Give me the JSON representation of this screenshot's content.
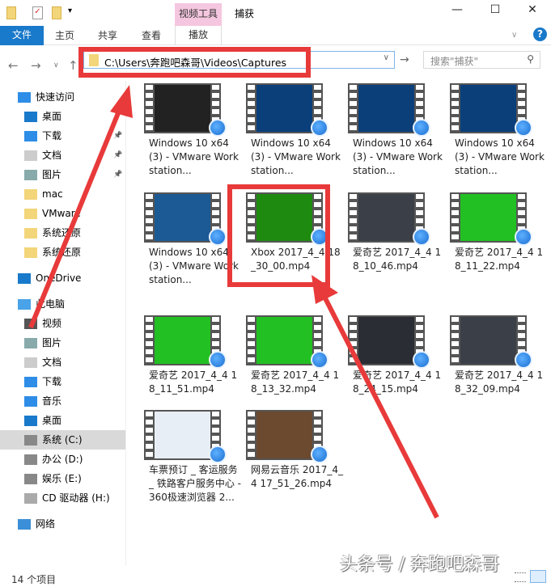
{
  "titlebar": {
    "context_tab": "视频工具",
    "title": "捕获",
    "minimize": "—",
    "maximize": "☐",
    "close": "✕"
  },
  "ribbon": {
    "file": "文件",
    "tabs": [
      "主页",
      "共享",
      "查看"
    ],
    "play": "播放",
    "help": "?"
  },
  "address": {
    "path": "C:\\Users\\奔跑吧森哥\\Videos\\Captures",
    "search_placeholder": "搜索\"捕获\""
  },
  "sidebar": {
    "items": [
      {
        "label": "快速访问",
        "icon": "star-icon"
      },
      {
        "label": "桌面",
        "icon": "desktop-icon"
      },
      {
        "label": "下载",
        "icon": "download-icon"
      },
      {
        "label": "文档",
        "icon": "document-icon"
      },
      {
        "label": "图片",
        "icon": "pictures-icon"
      },
      {
        "label": "mac",
        "icon": "folder-icon"
      },
      {
        "label": "VMware",
        "icon": "folder-icon"
      },
      {
        "label": "系统还原",
        "icon": "folder-icon"
      },
      {
        "label": "系统还原",
        "icon": "folder-icon"
      },
      {
        "label": "OneDrive",
        "icon": "cloud-icon"
      },
      {
        "label": "此电脑",
        "icon": "computer-icon"
      },
      {
        "label": "视频",
        "icon": "video-icon"
      },
      {
        "label": "图片",
        "icon": "pictures-icon"
      },
      {
        "label": "文档",
        "icon": "document-icon"
      },
      {
        "label": "下载",
        "icon": "download-icon"
      },
      {
        "label": "音乐",
        "icon": "music-icon"
      },
      {
        "label": "桌面",
        "icon": "desktop-icon"
      },
      {
        "label": "系统 (C:)",
        "icon": "drive-icon"
      },
      {
        "label": "办公 (D:)",
        "icon": "drive-icon"
      },
      {
        "label": "娱乐 (E:)",
        "icon": "drive-icon"
      },
      {
        "label": "CD 驱动器 (H:)",
        "icon": "cd-icon"
      },
      {
        "label": "网络",
        "icon": "network-icon"
      }
    ]
  },
  "files": [
    {
      "name": "Windows 10 x64 (3) - VMware Workstation...",
      "thumb": "#222"
    },
    {
      "name": "Windows 10 x64 (3) - VMware Workstation...",
      "thumb": "#0a3f7a"
    },
    {
      "name": "Windows 10 x64 (3) - VMware Workstation...",
      "thumb": "#0a3f7a"
    },
    {
      "name": "Windows 10 x64 (3) - VMware Workstation...",
      "thumb": "#0a3f7a"
    },
    {
      "name": "Windows 10 x64 (3) - VMware Workstation...",
      "thumb": "#1b5a94"
    },
    {
      "name": "Xbox 2017_4_4 18_30_00.mp4",
      "thumb": "#1f8a10"
    },
    {
      "name": "爱奇艺 2017_4_4 18_10_46.mp4",
      "thumb": "#3a3f48"
    },
    {
      "name": "爱奇艺 2017_4_4 18_11_22.mp4",
      "thumb": "#22c022"
    },
    {
      "name": "爱奇艺 2017_4_4 18_11_51.mp4",
      "thumb": "#22c022"
    },
    {
      "name": "爱奇艺 2017_4_4 18_13_32.mp4",
      "thumb": "#22c022"
    },
    {
      "name": "爱奇艺 2017_4_4 18_24_15.mp4",
      "thumb": "#2a2d33"
    },
    {
      "name": "爱奇艺 2017_4_4 18_32_09.mp4",
      "thumb": "#3a3f48"
    },
    {
      "name": "车票预订 _ 客运服务 _ 铁路客户服务中心 - 360极速浏览器 2...",
      "thumb": "#e8eef5"
    },
    {
      "name": "网易云音乐 2017_4_4 17_51_26.mp4",
      "thumb": "#6b4a30"
    }
  ],
  "status": "14 个项目",
  "watermark": "头条号 / 奔跑吧森哥",
  "colors": {
    "accent": "#1979ca",
    "highlight": "#e83a3a",
    "context_tab": "#f5c6df"
  }
}
